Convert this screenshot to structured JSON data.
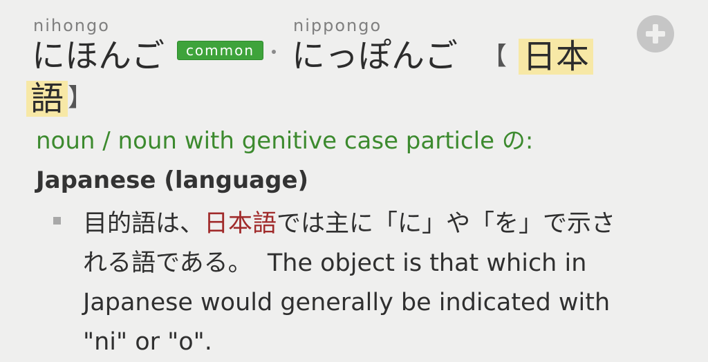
{
  "readings": [
    {
      "romaji": "nihongo",
      "kana": "にほんご",
      "badge": "common"
    },
    {
      "romaji": "nippongo",
      "kana": "にっぽんご"
    }
  ],
  "kanji": {
    "open_bracket": "【",
    "close_bracket": "】",
    "line1": "日本",
    "line2": "語"
  },
  "add_button": {
    "icon": "plus-icon"
  },
  "part_of_speech": "noun / noun with genitive case particle の:",
  "gloss": "Japanese (language)",
  "example": {
    "pre": "目的語は、",
    "highlight": "日本語",
    "post": "では主に「に」や「を」で示される語である。",
    "english": "The object is that which in Japanese would generally be indicated with \"ni\" or \"o\"."
  },
  "colors": {
    "background": "#efefee",
    "common_badge": "#3ea33b",
    "pos_text": "#3c8a2e",
    "kanji_highlight": "#f7e8a6",
    "example_highlight": "#a02a2a"
  }
}
